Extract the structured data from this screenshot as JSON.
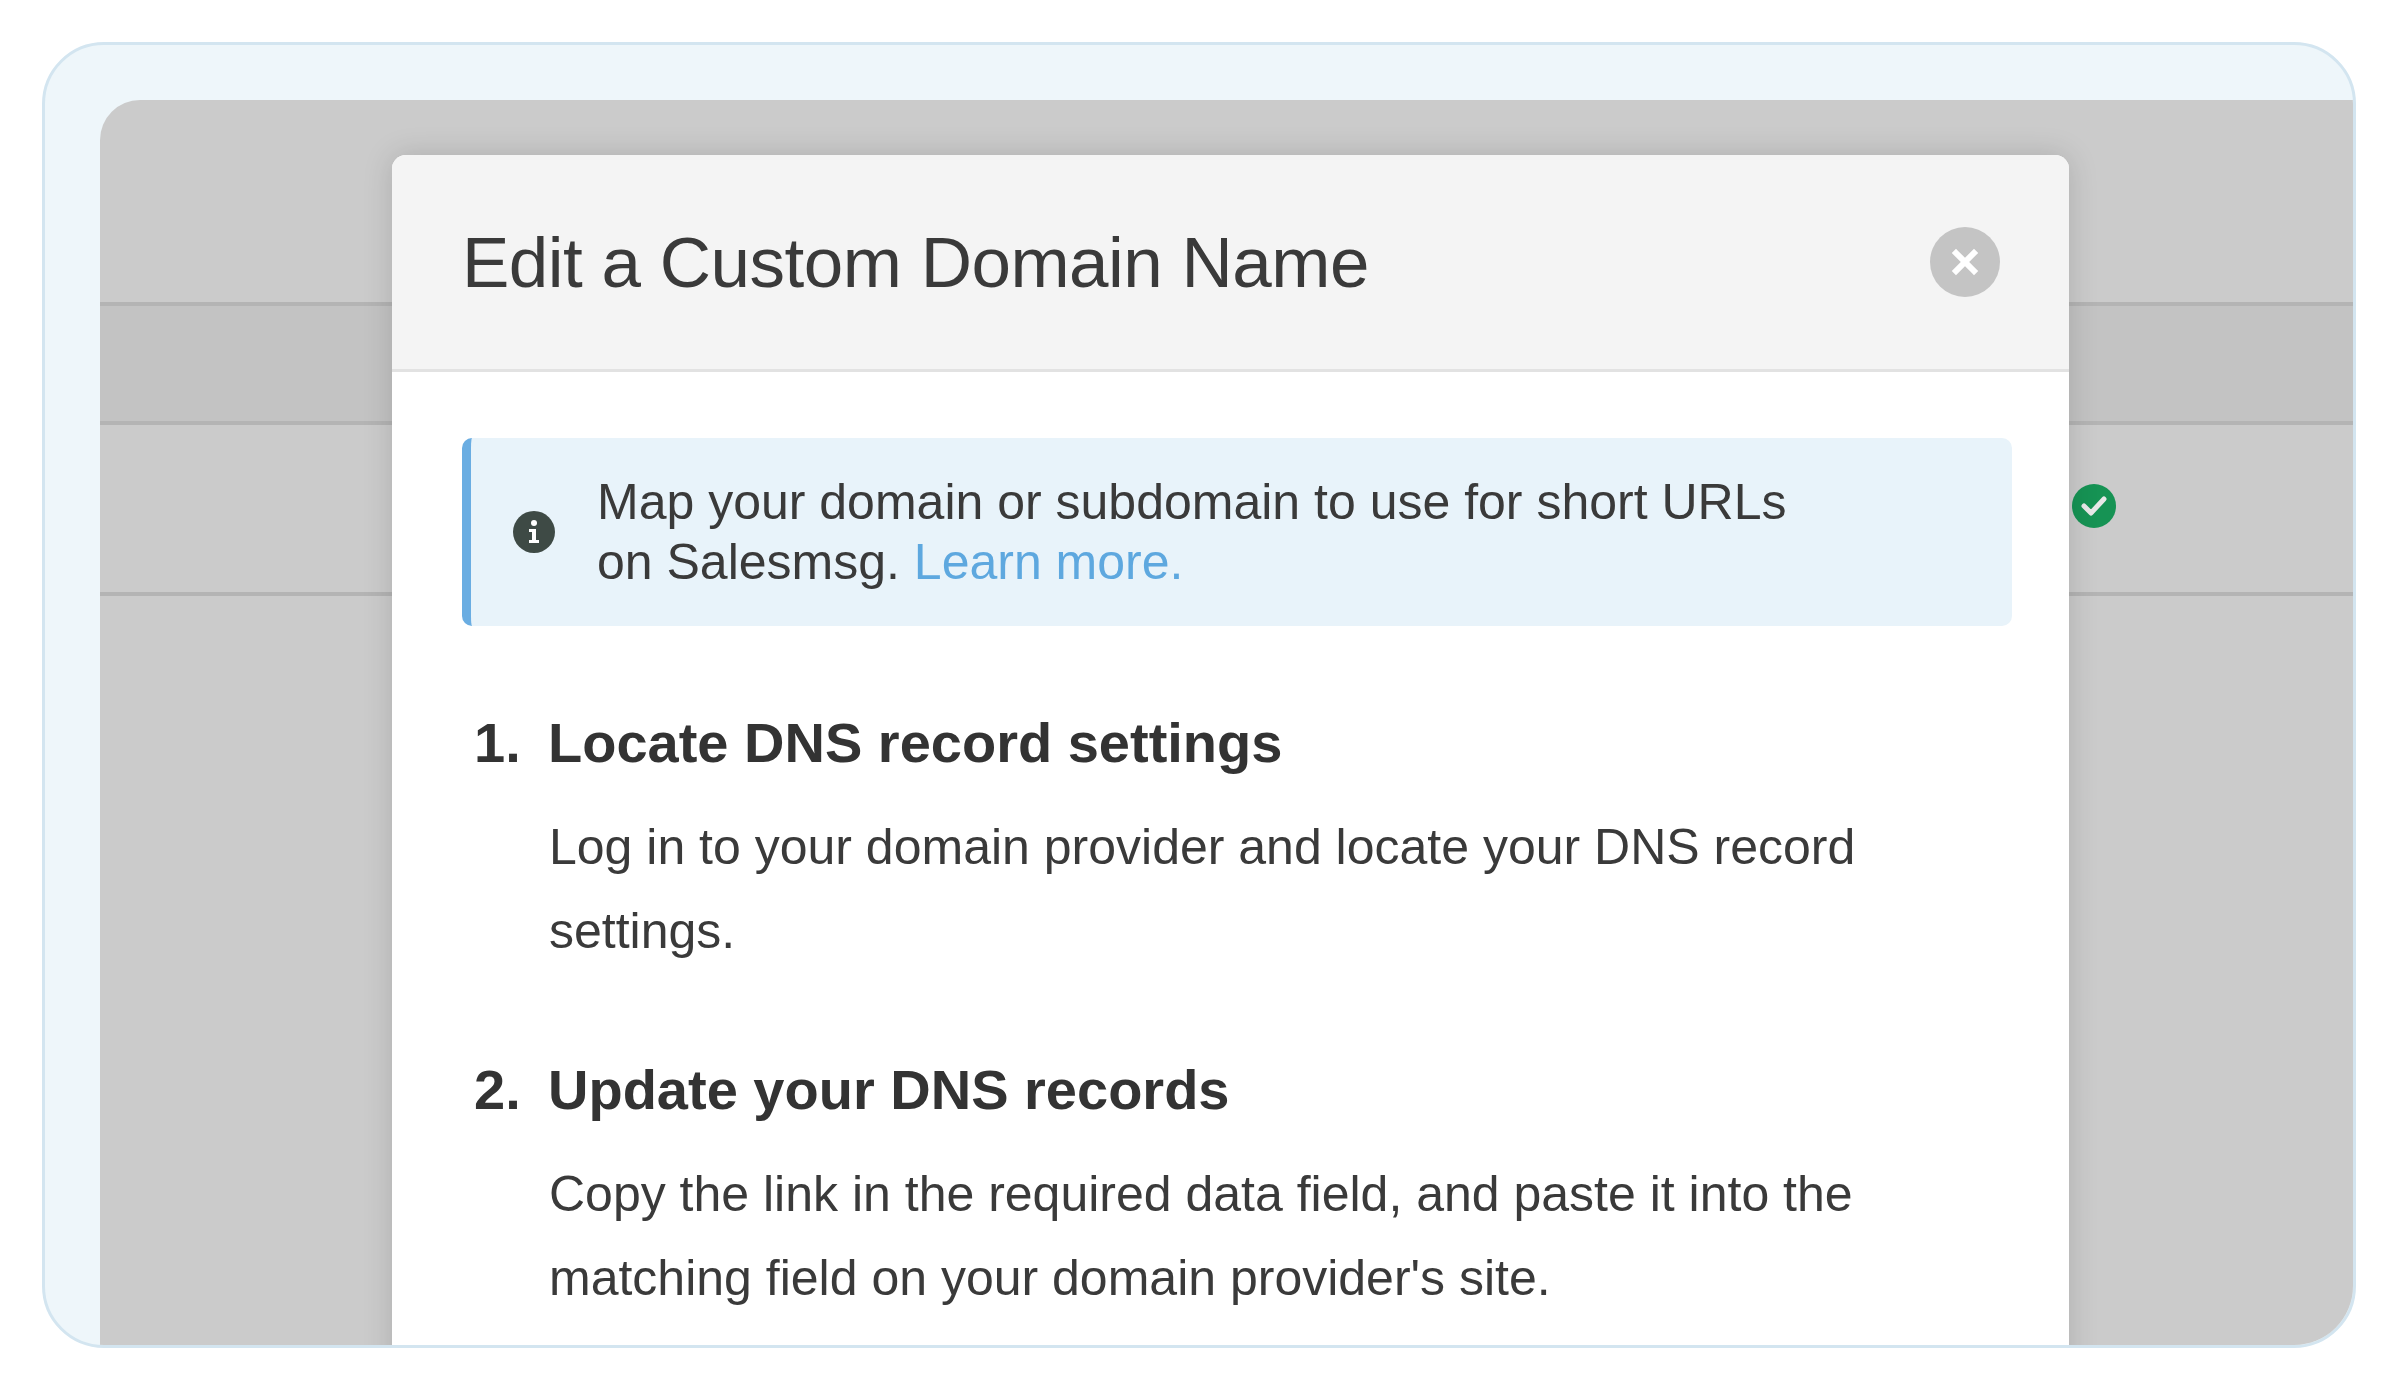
{
  "dialog": {
    "title": "Edit a Custom Domain Name",
    "info": {
      "text": "Map your domain or subdomain to use for short URLs on Salesmsg.",
      "link": "Learn more."
    },
    "steps": [
      {
        "number": "1.",
        "title": "Locate DNS record settings",
        "text": "Log in to your domain provider and locate your DNS record settings."
      },
      {
        "number": "2.",
        "title": "Update your DNS records",
        "text": "Copy the link in the required data field, and paste it into the matching field on your domain provider's site."
      }
    ]
  }
}
